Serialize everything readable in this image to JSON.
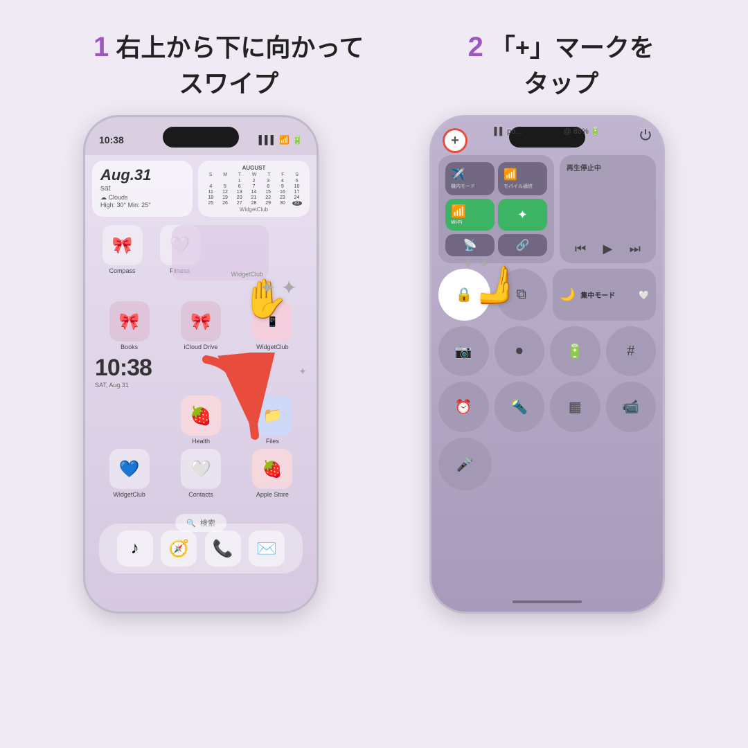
{
  "page": {
    "background": "#f0eaf5"
  },
  "header": {
    "step1_num": "1",
    "step1_text": "右上から下に向かって\nスワイプ",
    "step2_num": "2",
    "step2_text": "「+」マークを\nタップ"
  },
  "phone1": {
    "status_time": "10:38",
    "status_signal": "▌▌▌",
    "status_wifi": "wifi",
    "status_battery": "battery",
    "widget_date_big": "Aug.31",
    "widget_date_day": "sat",
    "widget_date_weather": "☁ Clouds\nHigh: 30° Min: 25°",
    "calendar_title": "AUGUST",
    "calendar_headers": [
      "S",
      "M",
      "T",
      "W",
      "T",
      "F",
      "S"
    ],
    "calendar_rows": [
      [
        "",
        "",
        "1",
        "2",
        "3",
        "4",
        "5"
      ],
      [
        "4",
        "5",
        "6",
        "7",
        "8",
        "9",
        "10"
      ],
      [
        "11",
        "12",
        "13",
        "14",
        "15",
        "16",
        "17"
      ],
      [
        "18",
        "19",
        "20",
        "21",
        "22",
        "23",
        "24"
      ],
      [
        "25",
        "26",
        "27",
        "28",
        "29",
        "30",
        "31"
      ]
    ],
    "widgetclub_label": "WidgetClub",
    "apps_row1": [
      {
        "icon": "🎀",
        "label": "Compass"
      },
      {
        "icon": "🤍",
        "label": "Fitness"
      },
      {
        "icon": "",
        "label": ""
      }
    ],
    "apps_row2": [
      {
        "icon": "🎀",
        "label": "Books"
      },
      {
        "icon": "🎀",
        "label": "iCloud Drive"
      },
      {
        "icon": "📱",
        "label": "WidgetClub"
      }
    ],
    "clock_time": "10:38",
    "clock_date": "SAT, Aug.31",
    "apps_row3": [
      {
        "icon": "",
        "label": ""
      },
      {
        "icon": "🍓",
        "label": "Health"
      },
      {
        "icon": "📁",
        "label": "Files"
      }
    ],
    "apps_row4": [
      {
        "icon": "💙",
        "label": "WidgetClub"
      },
      {
        "icon": "🤍",
        "label": "Contacts"
      },
      {
        "icon": "🍓",
        "label": "Apple Store"
      }
    ],
    "search_placeholder": "🔍 検索",
    "dock_apps": [
      "♪",
      "🧭",
      "📞",
      "✉️"
    ]
  },
  "phone2": {
    "plus_label": "+",
    "status_signal": "▌▌",
    "status_text": "po...",
    "status_battery": "@ 88%",
    "media_label": "再生停止中",
    "focus_label": "集中モード",
    "network_buttons": [
      "airplane",
      "cellular",
      "bluetooth",
      "wifi",
      "rotate",
      "cast"
    ],
    "cc_buttons_row2": [
      "lock-rotate",
      "screen-mirror",
      "moon",
      "focus"
    ],
    "cc_buttons_row3": [
      "camera",
      "record",
      "battery",
      "calculator"
    ],
    "cc_buttons_row4": [
      "alarm",
      "torch",
      "qr",
      "video"
    ],
    "cc_buttons_row5": [
      "voice"
    ]
  }
}
